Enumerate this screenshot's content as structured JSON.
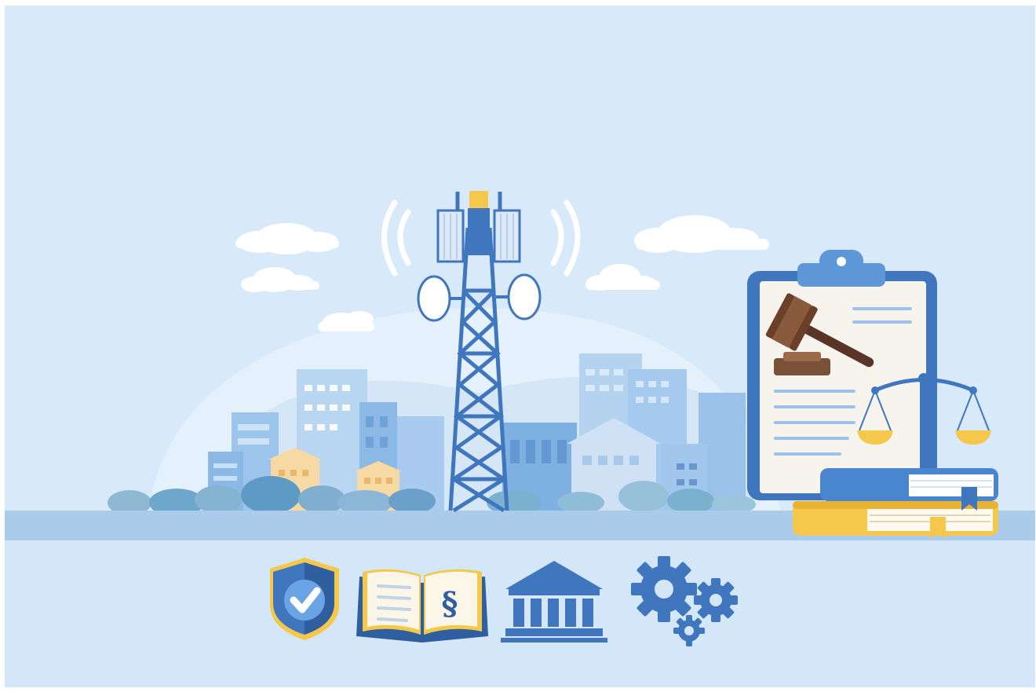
{
  "illustration": {
    "colors": {
      "sky": "#d8eafa",
      "ground_band": "#abcbea",
      "ground_bottom": "#d4e7f8",
      "tower": "#3f76bd",
      "tower_top": "#f5c84b",
      "panel": "#dde9f7",
      "signal": "#ffffff",
      "clipboard_frame": "#3f76bd",
      "paper": "#f7f4ee",
      "gavel": "#7a5038",
      "scale": "#3f76bd",
      "scale_pan": "#f5c84b",
      "book_blue": "#4a86cf",
      "book_yellow": "#f5c84b",
      "shield": "#3f76bd",
      "gears": "#3f76bd"
    },
    "icons": {
      "shield": "shield-check-icon",
      "book": "open-law-book-icon",
      "building": "government-building-icon",
      "gears": "gears-icon"
    },
    "book_glyph": "§"
  }
}
